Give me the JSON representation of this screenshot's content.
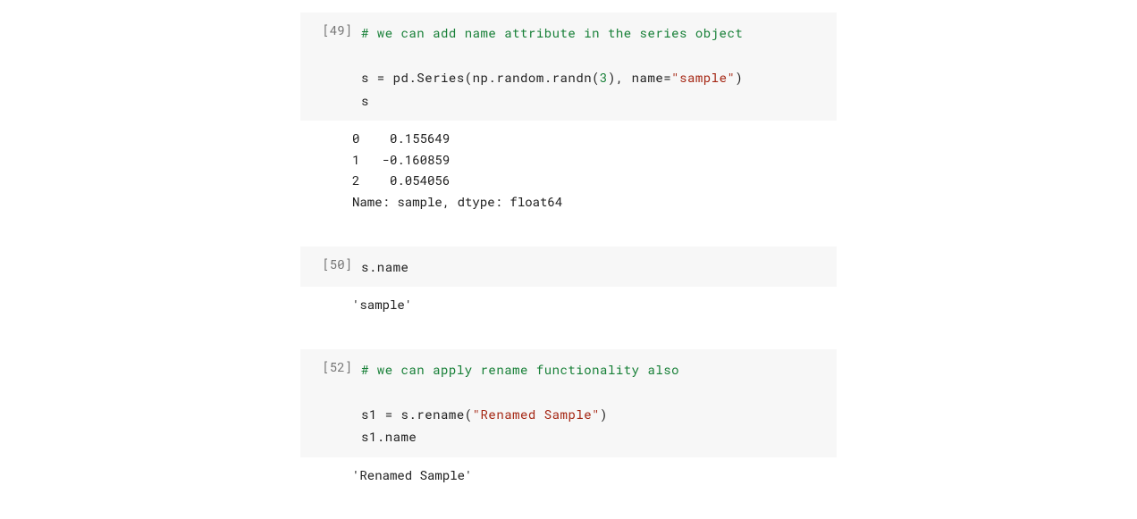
{
  "cells": [
    {
      "prompt": "[49]",
      "code": {
        "line1_comment": "# we can add name attribute in the series object",
        "line2a": "s = pd.Series(np.random.randn(",
        "line2_num": "3",
        "line2b": "), name=",
        "line2_str": "\"sample\"",
        "line2c": ")",
        "line3": "s"
      },
      "output": "0    0.155649\n1   -0.160859\n2    0.054056\nName: sample, dtype: float64"
    },
    {
      "prompt": "[50]",
      "code": {
        "line1": "s.name"
      },
      "output": "'sample'"
    },
    {
      "prompt": "[52]",
      "code": {
        "line1_comment": "# we can apply rename functionality also",
        "line2a": "s1 = s.rename(",
        "line2_str": "\"Renamed Sample\"",
        "line2b": ")",
        "line3": "s1.name"
      },
      "output": "'Renamed Sample'"
    }
  ]
}
